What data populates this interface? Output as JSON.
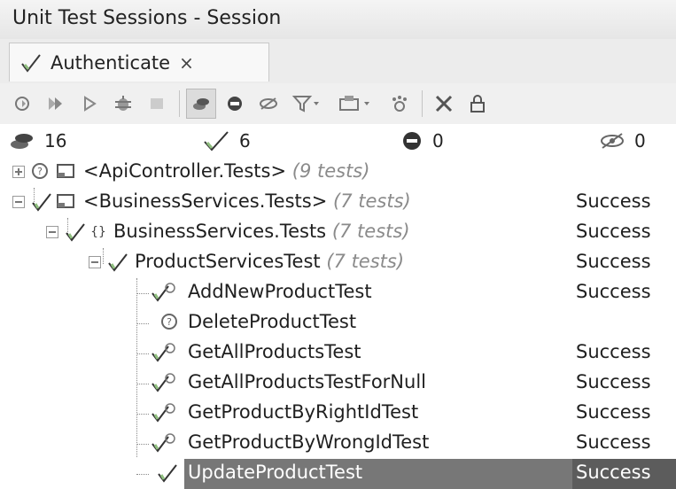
{
  "window": {
    "title": "Unit Test Sessions - Session"
  },
  "tab": {
    "label": "Authenticate",
    "close": "×"
  },
  "toolbar": {
    "buttons": [
      "run-all",
      "run-selected",
      "run",
      "debug",
      "stop",
      "show-all",
      "show-failed",
      "show-ignored",
      "filter",
      "group-by",
      "show-output",
      "cut",
      "lock"
    ]
  },
  "stats": {
    "total": "16",
    "passed": "6",
    "failed": "0",
    "ignored": "0"
  },
  "tree": [
    {
      "name": "<ApiController.Tests>",
      "count": "(9 tests)",
      "status": ""
    },
    {
      "name": "<BusinessServices.Tests>",
      "count": "(7 tests)",
      "status": "Success"
    },
    {
      "name": "BusinessServices.Tests",
      "count": "(7 tests)",
      "status": "Success"
    },
    {
      "name": "ProductServicesTest",
      "count": "(7 tests)",
      "status": "Success"
    },
    {
      "name": "AddNewProductTest",
      "count": "",
      "status": "Success"
    },
    {
      "name": "DeleteProductTest",
      "count": "",
      "status": ""
    },
    {
      "name": "GetAllProductsTest",
      "count": "",
      "status": "Success"
    },
    {
      "name": "GetAllProductsTestForNull",
      "count": "",
      "status": "Success"
    },
    {
      "name": "GetProductByRightIdTest",
      "count": "",
      "status": "Success"
    },
    {
      "name": "GetProductByWrongIdTest",
      "count": "",
      "status": "Success"
    },
    {
      "name": "UpdateProductTest",
      "count": "",
      "status": "Success"
    }
  ],
  "colors": {
    "success_check": "#4a9a3a",
    "unknown": "#6a6a6a",
    "selection": "#777777"
  }
}
